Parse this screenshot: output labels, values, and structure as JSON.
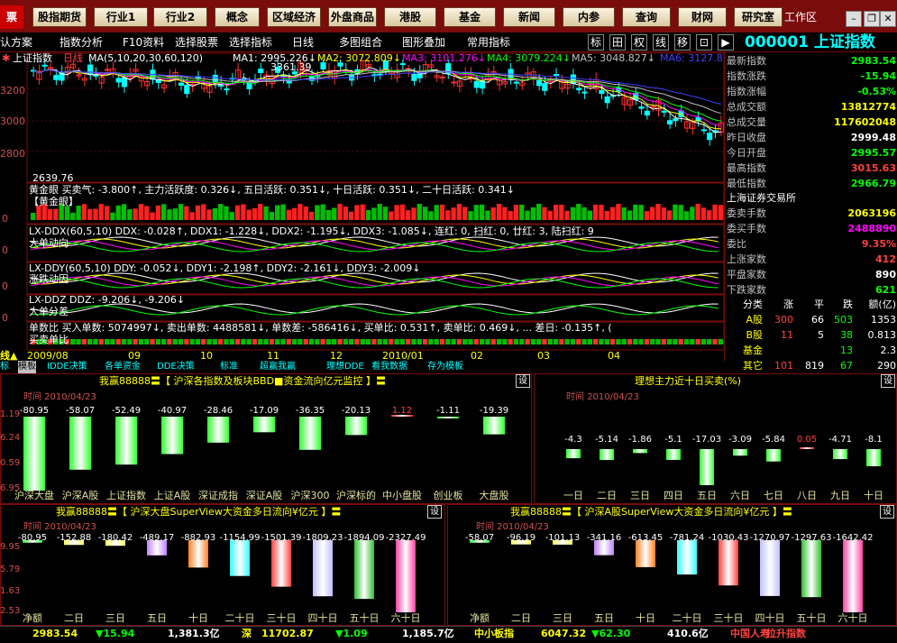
{
  "topnav": {
    "brand": "票",
    "buttons": [
      "股指期货",
      "行业1",
      "行业2",
      "概念",
      "区域经济",
      "外盘商品",
      "港股",
      "基金",
      "新闻",
      "内参",
      "查询",
      "财网",
      "研究室"
    ],
    "workarea": "工作区"
  },
  "toolbar": {
    "items": [
      "认方案",
      "指数分析",
      "F10资料",
      "选择股票",
      "选择指标",
      "日线",
      "多图组合",
      "图形叠加",
      "常用指标"
    ],
    "squares": [
      "标",
      "田",
      "权",
      "线",
      "移",
      "⊡",
      "▶"
    ],
    "index_title": "000001 上证指数"
  },
  "main_chart": {
    "header": {
      "name": "上证指数",
      "period": "日线",
      "ma_params": "MA(5,10,20,30,60,120)",
      "ma1": "MA1: 2995.226↓",
      "ma2": "MA2: 3072.809↓",
      "ma3": "MA3: 3101.276↓",
      "ma4": "MA4: 3079.224↓",
      "ma5": "MA5: 3048.827↓",
      "ma6": "MA6: 3127.8"
    },
    "high_label": "3361.39",
    "low_label": "2639.76",
    "y_ticks": [
      "3200",
      "3000",
      "2800"
    ],
    "colors": {
      "ma1": "#ffffff",
      "ma2": "#ffff00",
      "ma3": "#ff00ff",
      "ma4": "#00ff00",
      "ma5": "#c0c0c0",
      "ma6": "#4040ff"
    }
  },
  "sub_panels": {
    "gold_eye": {
      "line": "黄金眼  买卖气: -3.800↑, 主力活跃度: 0.326↓, 五日活跃: 0.351↓, 十日活跃: 0.351↓, 二十日活跃: 0.341↓",
      "tag": "【黄金眼】"
    },
    "ddx": {
      "line": "LX-DDX(60,5,10)  DDX: -0.028↑, DDX1: -1.228↓, DDX2: -1.195↓, DDX3: -1.085↓, 连红: 0, 扫红: 0, 廿红: 3, 陆扫红: 9",
      "tag": "大单动向"
    },
    "ddy": {
      "line": "LX-DDY(60,5,10)  DDY: -0.052↓, DDY1: -2.198↑, DDY2: -2.161↓, DDY3: -2.009↓",
      "tag": "涨跌动因"
    },
    "ddz": {
      "line": "LX-DDZ  DDZ: -9.206↓, -9.206↓",
      "tag": "大单分差"
    },
    "single": {
      "line": "单数比  买入单数: 5074997↓, 卖出单数: 4488581↓, 单数差: -586416↓, 买单比: 0.531↑, 卖单比: 0.469↓, ...  差日: -0.135↑, (",
      "tag": "买卖单比"
    },
    "y_tick_zero": "0"
  },
  "date_axis": {
    "corner": "线▲",
    "dates": [
      "2009/08",
      "09",
      "10",
      "11",
      "12",
      "2010/01",
      "02",
      "03",
      "04"
    ]
  },
  "quote": {
    "rows": [
      {
        "k": "最新指数",
        "v": "2983.54",
        "c": "#00ff00"
      },
      {
        "k": "指数涨跌",
        "v": "-15.94",
        "c": "#00ff00"
      },
      {
        "k": "指数涨幅",
        "v": "-0.53%",
        "c": "#00ff00"
      },
      {
        "k": "总成交额",
        "v": "13812774",
        "c": "#ffff00"
      },
      {
        "k": "总成交量",
        "v": "117602048",
        "c": "#ffff00"
      },
      {
        "k": "昨日收盘",
        "v": "2999.48",
        "c": "#ffffff"
      },
      {
        "k": "今日开盘",
        "v": "2995.57",
        "c": "#00ff00"
      },
      {
        "k": "最高指数",
        "v": "3015.63",
        "c": "#ff4040"
      },
      {
        "k": "最低指数",
        "v": "2966.79",
        "c": "#00ff00"
      }
    ],
    "exchange": "上海证券交易所",
    "rows2": [
      {
        "k": "委卖手数",
        "v": "2063196",
        "c": "#ffff00"
      },
      {
        "k": "委买手数",
        "v": "2488890",
        "c": "#ff00ff"
      },
      {
        "k": "委比",
        "v": "9.35%",
        "c": "#ff4040"
      },
      {
        "k": "上涨家数",
        "v": "412",
        "c": "#ff4040"
      },
      {
        "k": "平盘家数",
        "v": "890",
        "c": "#ffffff"
      },
      {
        "k": "下跌家数",
        "v": "621",
        "c": "#00ff00"
      }
    ],
    "stat_header": [
      "分类",
      "涨",
      "平",
      "跌",
      "额(亿)"
    ],
    "stat_rows": [
      {
        "n": "A股",
        "up": "300",
        "flat": "66",
        "down": "503",
        "amt": "1353"
      },
      {
        "n": "B股",
        "up": "11",
        "flat": "5",
        "down": "38",
        "amt": "0.813"
      },
      {
        "n": "基金",
        "up": "",
        "flat": "",
        "down": "13",
        "amt": "2.3"
      },
      {
        "n": "其它",
        "up": "101",
        "flat": "819",
        "down": "67",
        "amt": "290"
      }
    ]
  },
  "tabs": [
    "标",
    "模板",
    "IDDE决策",
    "各单资金",
    "DDE决策",
    "标准",
    "超赢我赢",
    "理想DDE",
    "看我数据",
    "存为模板"
  ],
  "panel1": {
    "title": "我赢88888〓【 沪深各指数及板块BBD■资金流向亿元监控 】〓",
    "settings": "设",
    "date": "时间 2010/04/23",
    "y_ticks": [
      "1.19",
      "6.24",
      "0.59",
      "6.95"
    ]
  },
  "panel2": {
    "title": "理想主力近十日买卖(%)",
    "settings": "设",
    "date": "时间 2010/04/23"
  },
  "panel3": {
    "title": "我赢88888〓【 沪深大盘SuperView大资金多日流向¥亿元 】〓",
    "settings": "设",
    "date": "时间 2010/04/23",
    "y_ticks": [
      "9.95",
      "5.79",
      "1.63",
      "2.53"
    ]
  },
  "panel4": {
    "title": "我赢88888〓【 沪深A股SuperView大资金多日流向¥亿元 】〓",
    "settings": "设",
    "date": "时间 2010/04/23"
  },
  "chart_data": [
    {
      "type": "bar",
      "title": "沪深各指数及板块BBD资金流向亿元监控",
      "categories": [
        "沪深大盘",
        "沪深A股",
        "上证指数",
        "上证A股",
        "深证成指",
        "深证A股",
        "沪深300",
        "沪深标的",
        "中小盘股",
        "创业板",
        "大盘股"
      ],
      "values": [
        -80.95,
        -58.07,
        -52.49,
        -40.97,
        -28.46,
        -17.09,
        -36.35,
        -20.13,
        1.12,
        -1.11,
        -19.39
      ]
    },
    {
      "type": "bar",
      "title": "理想主力近十日买卖(%)",
      "categories": [
        "一日",
        "二日",
        "三日",
        "四日",
        "五日",
        "六日",
        "七日",
        "八日",
        "九日",
        "十日"
      ],
      "values": [
        -4.3,
        -5.14,
        -1.86,
        -5.1,
        -17.03,
        -3.09,
        -5.84,
        0.05,
        -4.71,
        -8.1
      ]
    },
    {
      "type": "bar",
      "title": "沪深大盘SuperView大资金多日流向¥亿元",
      "categories": [
        "净额",
        "二日",
        "三日",
        "五日",
        "十日",
        "二十日",
        "三十日",
        "四十日",
        "五十日",
        "六十日"
      ],
      "values": [
        -80.95,
        -152.88,
        -180.42,
        -489.17,
        -882.93,
        -1154.99,
        -1501.39,
        -1809.23,
        -1894.09,
        -2327.49
      ]
    },
    {
      "type": "bar",
      "title": "沪深A股SuperView大资金多日流向¥亿元",
      "categories": [
        "净额",
        "二日",
        "三日",
        "五日",
        "十日",
        "二十日",
        "三十日",
        "四十日",
        "五十日",
        "六十日"
      ],
      "values": [
        -58.07,
        -96.19,
        -101.13,
        -341.16,
        -613.45,
        -781.24,
        -1030.43,
        -1270.97,
        -1297.63,
        -1642.42
      ]
    }
  ],
  "status": {
    "items": [
      {
        "t": "2983.54",
        "c": "#ffff00"
      },
      {
        "t": "▼15.94",
        "c": "#00ff00"
      },
      {
        "t": "1,381.3亿",
        "c": "#ffffff"
      },
      {
        "t": "深",
        "c": "#ffff00"
      },
      {
        "t": "11702.87",
        "c": "#ffff00"
      },
      {
        "t": "▼1.09",
        "c": "#00ff00"
      },
      {
        "t": "1,185.7亿",
        "c": "#ffffff"
      },
      {
        "t": "中小板指",
        "c": "#ffff00"
      },
      {
        "t": "6047.32",
        "c": "#ffff00"
      },
      {
        "t": "▼62.30",
        "c": "#00ff00"
      },
      {
        "t": "410.6亿",
        "c": "#ffffff"
      },
      {
        "t": "中国人寿",
        "c": "#ff4040"
      },
      {
        "t": "拉升指数",
        "c": "#ff4040"
      }
    ]
  }
}
